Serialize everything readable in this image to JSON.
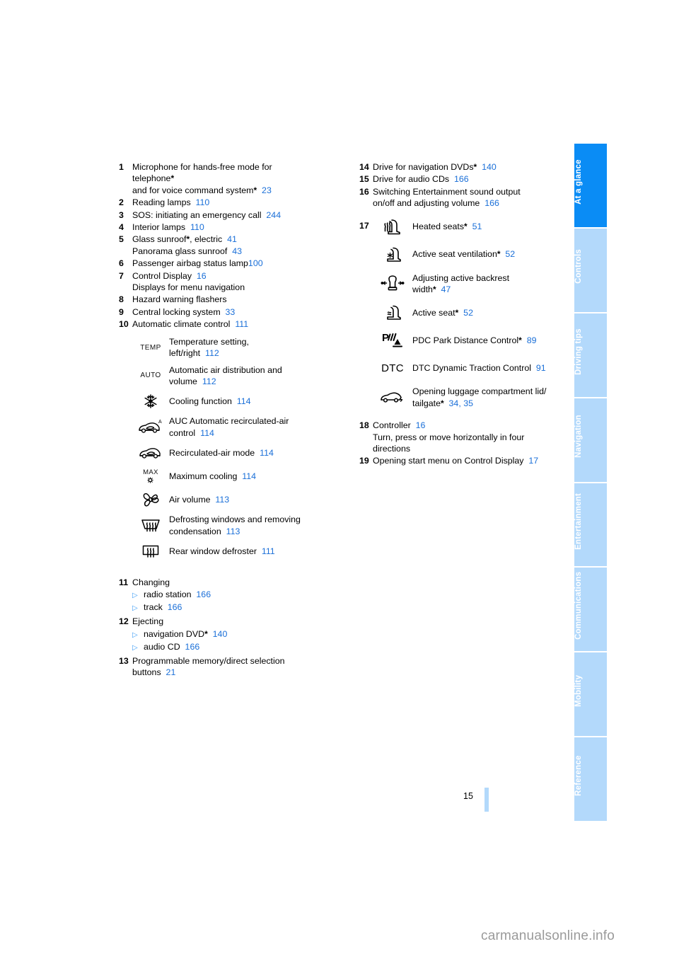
{
  "page": {
    "number": "15",
    "watermark": "carmanualsonline.info"
  },
  "sidebar": {
    "tabs": [
      {
        "label": "At a glance",
        "active": true
      },
      {
        "label": "Controls",
        "active": false
      },
      {
        "label": "Driving tips",
        "active": false
      },
      {
        "label": "Navigation",
        "active": false
      },
      {
        "label": "Entertainment",
        "active": false
      },
      {
        "label": "Communications",
        "active": false
      },
      {
        "label": "Mobility",
        "active": false
      },
      {
        "label": "Reference",
        "active": false
      }
    ],
    "colors": {
      "active": "#0a8cf5",
      "inactive": "#b3d9fb",
      "label": "#ffffff"
    }
  },
  "colors": {
    "page_link": "#1a6fd8",
    "bullet": "#3b9cf5",
    "text": "#000000"
  },
  "left_column": {
    "items": [
      {
        "num": "1",
        "line1": "Microphone for hands-free mode for",
        "line2": "telephone",
        "star2": "*",
        "line3": "and for voice command system",
        "star3": "*",
        "page3": "23"
      },
      {
        "num": "2",
        "line1": "Reading lamps",
        "page1": "110"
      },
      {
        "num": "3",
        "line1": "SOS: initiating an emergency call",
        "page1": "244"
      },
      {
        "num": "4",
        "line1": "Interior lamps",
        "page1": "110"
      },
      {
        "num": "5",
        "line1": "Glass sunroof",
        "star1": "*",
        "line1b": ", electric",
        "page1": "41",
        "line2": "Panorama glass sunroof",
        "page2": "43"
      },
      {
        "num": "6",
        "line1": "Passenger airbag status lamp",
        "page1": "100"
      },
      {
        "num": "7",
        "line1": "Control Display",
        "page1": "16",
        "line2": "Displays for menu navigation"
      },
      {
        "num": "8",
        "line1": "Hazard warning flashers"
      },
      {
        "num": "9",
        "line1": "Central locking system",
        "page1": "33"
      },
      {
        "num": "10",
        "line1": "Automatic climate control",
        "page1": "111"
      }
    ],
    "climate_icons": [
      {
        "icon": "temp-icon",
        "glyph": "TEMP",
        "line1": "Temperature setting,",
        "line2": "left/right",
        "page": "112"
      },
      {
        "icon": "auto-icon",
        "glyph": "AUTO",
        "line1": "Automatic air distribution and",
        "line2": "volume",
        "page": "112"
      },
      {
        "icon": "snowflake-icon",
        "glyph": "",
        "line1": "Cooling function",
        "page": "114"
      },
      {
        "icon": "auc-recirculation-car-icon",
        "glyph": "",
        "line1": "AUC Automatic recirculated-air",
        "line2": "control",
        "page": "114"
      },
      {
        "icon": "recirculation-car-icon",
        "glyph": "",
        "line1": "Recirculated-air mode",
        "page": "114"
      },
      {
        "icon": "max-cooling-icon",
        "glyph": "MAX",
        "line1": "Maximum cooling",
        "page": "114"
      },
      {
        "icon": "fan-icon",
        "glyph": "",
        "line1": "Air volume",
        "page": "113"
      },
      {
        "icon": "windshield-defrost-icon",
        "glyph": "",
        "line1": "Defrosting windows and removing",
        "line2": "condensation",
        "page": "113"
      },
      {
        "icon": "rear-window-defroster-icon",
        "glyph": "",
        "line1": "Rear window defroster",
        "page": "111"
      }
    ],
    "items_b": [
      {
        "num": "11",
        "title": "Changing",
        "bullets": [
          {
            "label": "radio station",
            "page": "166"
          },
          {
            "label": "track",
            "page": "166"
          }
        ]
      },
      {
        "num": "12",
        "title": "Ejecting",
        "bullets": [
          {
            "label": "navigation DVD",
            "star": "*",
            "page": "140"
          },
          {
            "label": "audio CD",
            "page": "166"
          }
        ]
      },
      {
        "num": "13",
        "line1": "Programmable memory/direct selection",
        "line2": "buttons",
        "page2": "21"
      }
    ]
  },
  "right_column": {
    "items_top": [
      {
        "num": "14",
        "line1": "Drive for navigation DVDs",
        "star1": "*",
        "page1": "140"
      },
      {
        "num": "15",
        "line1": "Drive for audio CDs",
        "page1": "166"
      },
      {
        "num": "16",
        "line1": "Switching Entertainment sound output",
        "line2": "on/off and adjusting volume",
        "page2": "166"
      }
    ],
    "group17": {
      "num": "17",
      "rows": [
        {
          "icon": "heated-seat-icon",
          "glyph": "",
          "line1": "Heated seats",
          "star": "*",
          "page": "51"
        },
        {
          "icon": "seat-ventilation-icon",
          "glyph": "",
          "line1": "Active seat ventilation",
          "star": "*",
          "page": "52"
        },
        {
          "icon": "backrest-width-icon",
          "glyph": "",
          "line1": "Adjusting active backrest",
          "line2": "width",
          "star": "*",
          "page": "47"
        },
        {
          "icon": "active-seat-icon",
          "glyph": "",
          "line1": "Active seat",
          "star": "*",
          "page": "52"
        },
        {
          "icon": "pdc-icon",
          "glyph": "",
          "line1": "PDC Park Distance Control",
          "star": "*",
          "page": "89"
        },
        {
          "icon": "dtc-icon",
          "glyph": "DTC",
          "line1": "DTC Dynamic Traction Control",
          "page": "91"
        },
        {
          "icon": "trunk-lid-icon",
          "glyph": "",
          "line1": "Opening luggage compartment lid/",
          "line2": "tailgate",
          "star": "*",
          "page": "34",
          "page_b": "35"
        }
      ]
    },
    "items_bottom": [
      {
        "num": "18",
        "line1": "Controller",
        "page1": "16",
        "line2": "Turn, press or move horizontally in four",
        "line3": "directions"
      },
      {
        "num": "19",
        "line1": "Opening start menu on Control Display",
        "page1": "17"
      }
    ]
  }
}
